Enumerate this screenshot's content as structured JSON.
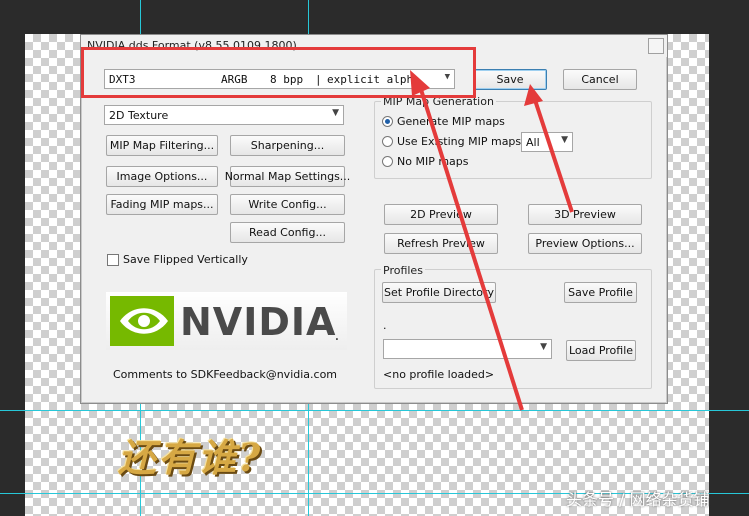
{
  "dialog": {
    "title": "NVIDIA dds Format (v8.55.0109.1800)",
    "format_combo": {
      "format": "DXT3",
      "color": "ARGB",
      "bpp": "8 bpp",
      "alpha": "explicit alpha"
    },
    "texture_combo": "2D Texture",
    "save_label": "Save",
    "cancel_label": "Cancel",
    "left_buttons": {
      "mip_filtering": "MIP Map Filtering...",
      "sharpening": "Sharpening...",
      "image_options": "Image Options...",
      "normal_map": "Normal Map Settings...",
      "fading": "Fading MIP maps...",
      "write_config": "Write Config...",
      "read_config": "Read Config..."
    },
    "save_flipped": "Save Flipped Vertically",
    "mip_group": {
      "label": "MIP Map Generation",
      "generate": "Generate MIP maps",
      "use_existing": "Use Existing MIP maps",
      "all_value": "All",
      "no_mip": "No MIP maps"
    },
    "preview": {
      "preview_2d": "2D Preview",
      "preview_3d": "3D Preview",
      "refresh": "Refresh Preview",
      "options": "Preview Options..."
    },
    "profiles": {
      "label": "Profiles",
      "set_dir": "Set Profile Directory",
      "save_profile": "Save Profile",
      "dot": ".",
      "load_profile": "Load Profile",
      "status": "<no profile loaded>"
    },
    "logo_text": "NVIDIA",
    "feedback": "Comments to SDKFeedback@nvidia.com"
  },
  "overlay": {
    "title_art": "还有谁?",
    "watermark": "头条号 / 网络杂货铺"
  },
  "colors": {
    "highlight": "#e43b3b",
    "nvidia_green": "#76b900",
    "guide": "#27c7d8"
  }
}
